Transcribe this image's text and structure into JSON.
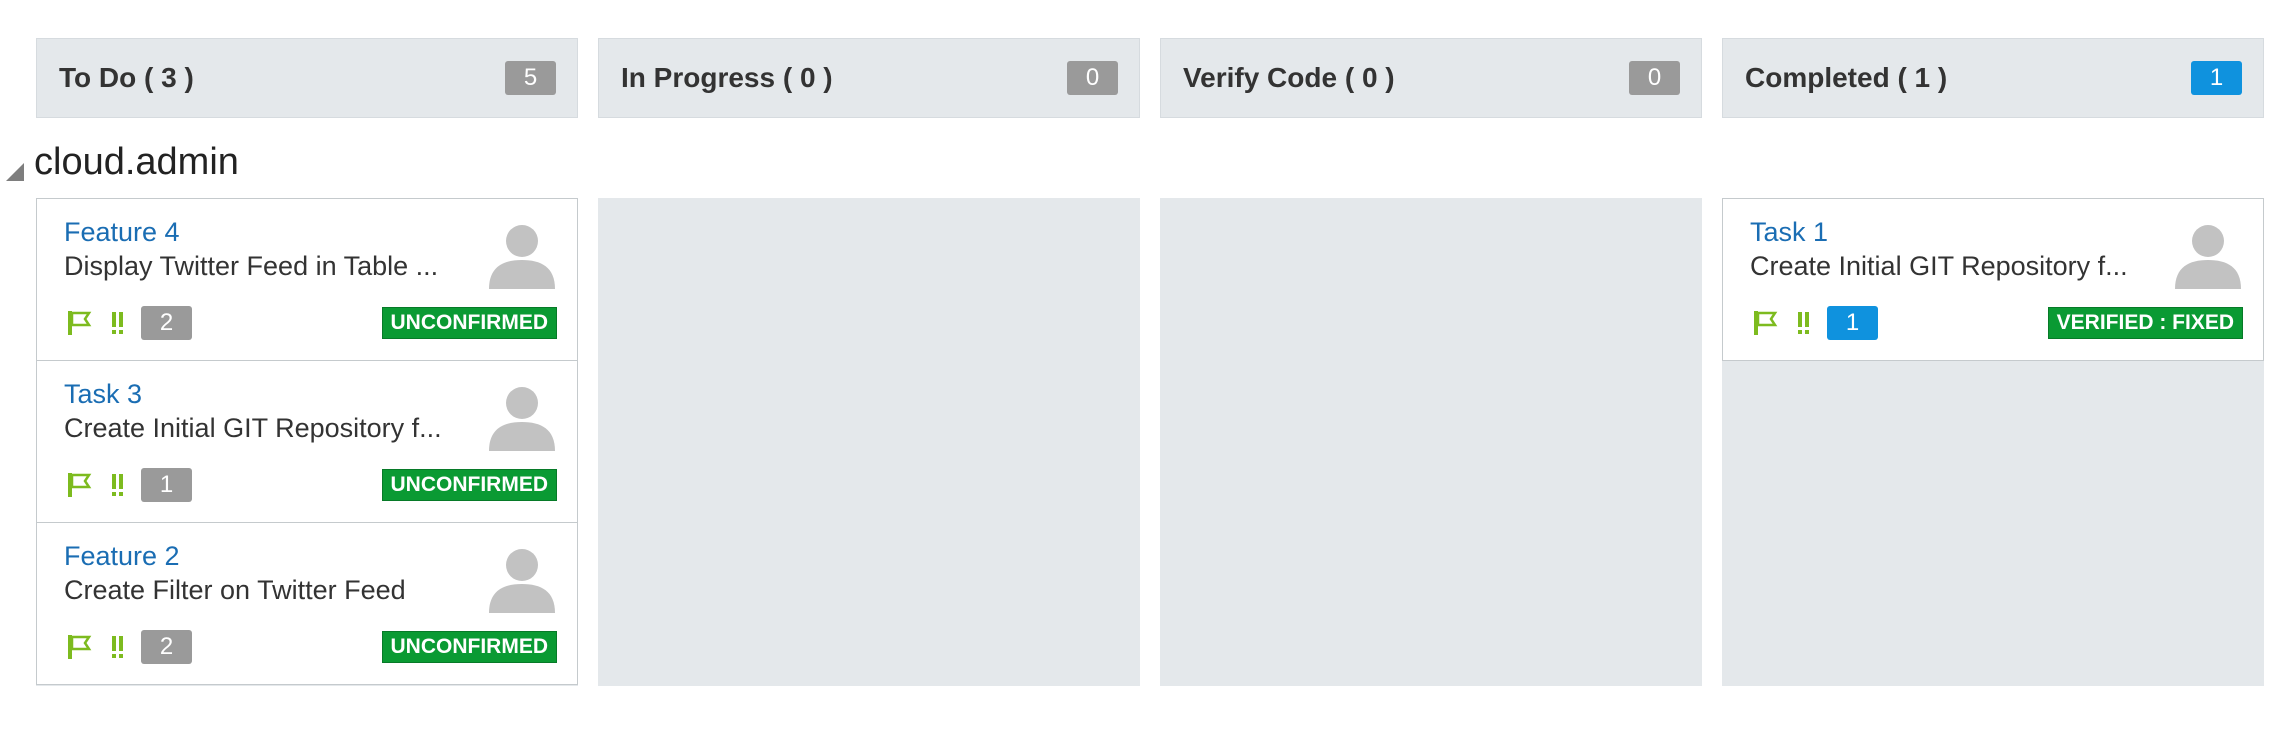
{
  "columns": [
    {
      "title": "To Do ( 3 )",
      "count": "5",
      "count_color": "#9a9a9a"
    },
    {
      "title": "In Progress ( 0 )",
      "count": "0",
      "count_color": "#9a9a9a"
    },
    {
      "title": "Verify Code ( 0 )",
      "count": "0",
      "count_color": "#9a9a9a"
    },
    {
      "title": "Completed ( 1 )",
      "count": "1",
      "count_color": "#0f92de"
    }
  ],
  "swimlane": {
    "title": "cloud.admin",
    "collapse_icon": "triangle-down-icon"
  },
  "todo_cards": [
    {
      "title": "Feature 4",
      "description": "Display Twitter Feed in Table ...",
      "points": "2",
      "status": "UNCONFIRMED"
    },
    {
      "title": "Task 3",
      "description": "Create Initial GIT Repository f...",
      "points": "1",
      "status": "UNCONFIRMED"
    },
    {
      "title": "Feature 2",
      "description": "Create Filter on Twitter Feed",
      "points": "2",
      "status": "UNCONFIRMED"
    }
  ],
  "completed_cards": [
    {
      "title": "Task 1",
      "description": "Create Initial GIT Repository f...",
      "points": "1",
      "status": "VERIFIED : FIXED"
    }
  ],
  "colors": {
    "accent_blue": "#0f92de",
    "link_blue": "#1a6db3",
    "status_green": "#0a9a33",
    "flag_green": "#7dbb1f",
    "lane_bg": "#e4e8eb"
  },
  "icons": [
    "flag-icon",
    "priority-high-icon",
    "avatar-icon"
  ]
}
